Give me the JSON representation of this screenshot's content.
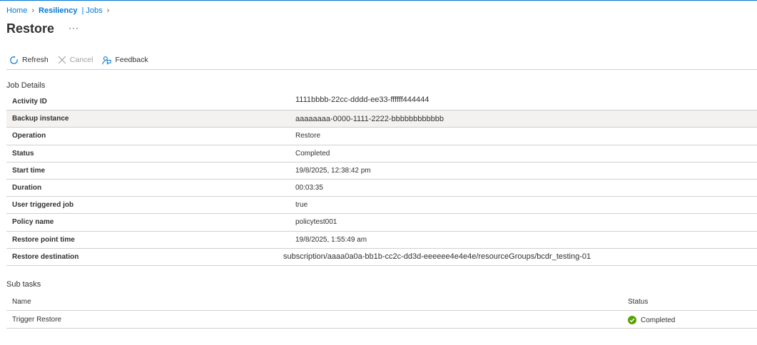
{
  "breadcrumb": {
    "items": [
      "Home",
      "Resiliency",
      "| Jobs"
    ]
  },
  "page": {
    "title": "Restore",
    "more": "···"
  },
  "toolbar": {
    "refresh_label": "Refresh",
    "cancel_label": "Cancel",
    "feedback_label": "Feedback"
  },
  "job_details": {
    "heading": "Job Details",
    "rows": [
      {
        "label": "Activity ID",
        "value": "1111bbbb-22cc-dddd-ee33-ffffff444444"
      },
      {
        "label": "Backup instance",
        "value": "aaaaaaaa-0000-1111-2222-bbbbbbbbbbbb"
      },
      {
        "label": "Operation",
        "value": "Restore"
      },
      {
        "label": "Status",
        "value": "Completed"
      },
      {
        "label": "Start time",
        "value": "19/8/2025, 12:38:42 pm"
      },
      {
        "label": "Duration",
        "value": "00:03:35"
      },
      {
        "label": "User triggered job",
        "value": "true"
      },
      {
        "label": "Policy name",
        "value": "policytest001"
      },
      {
        "label": "Restore point time",
        "value": "19/8/2025, 1:55:49 am"
      },
      {
        "label": "Restore destination",
        "value": "subscription/aaaa0a0a-bb1b-cc2c-dd3d-eeeeee4e4e4e/resourceGroups/bcdr_testing-01"
      }
    ]
  },
  "sub_tasks": {
    "heading": "Sub tasks",
    "columns": [
      "Name",
      "Status"
    ],
    "rows": [
      {
        "name": "Trigger Restore",
        "status": "Completed"
      }
    ]
  },
  "colors": {
    "accent": "#0078d4",
    "success": "#57a300"
  }
}
